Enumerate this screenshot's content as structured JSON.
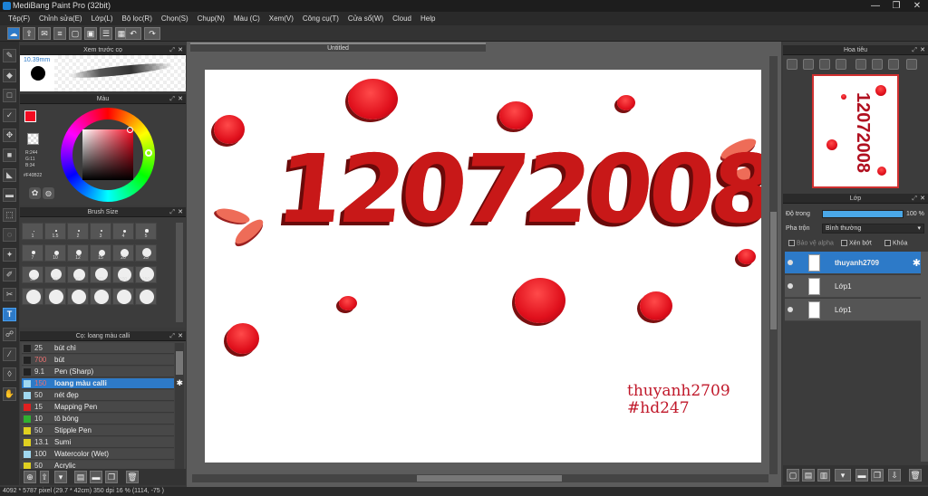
{
  "window": {
    "title": "MediBang Paint Pro (32bit)",
    "minimize": "—",
    "maximize": "❐",
    "close": "✕"
  },
  "menu": [
    "Tệp(F)",
    "Chỉnh sửa(E)",
    "Lớp(L)",
    "Bộ lọc(R)",
    "Chọn(S)",
    "Chụp(N)",
    "Màu (C)",
    "Xem(V)",
    "Công cụ(T)",
    "Cửa sổ(W)",
    "Cloud",
    "Help"
  ],
  "preview": {
    "title": "Xem trước cọ",
    "size": "10.39mm"
  },
  "color": {
    "title": "Màu",
    "r": "R:244",
    "g": "G:11",
    "b": "B:34",
    "hex": "#F40B22",
    "primary": "#f40b22",
    "secondary": "#2db34a"
  },
  "brush_size": {
    "title": "Brush Size",
    "sizes": [
      "1",
      "1.5",
      "2",
      "3",
      "4",
      "5",
      "7",
      "10",
      "12",
      "15",
      "20",
      "25",
      "30",
      "40",
      "50",
      "70",
      "100",
      "150",
      "",
      "",
      "",
      "",
      "",
      ""
    ]
  },
  "brush_list": {
    "title": "Cọ: loang màu calli",
    "items": [
      {
        "size": "25",
        "name": "bút chì",
        "color": "#222222"
      },
      {
        "size": "700",
        "name": "bút",
        "color": "#222222"
      },
      {
        "size": "9.1",
        "name": "Pen (Sharp)",
        "color": "#222222"
      },
      {
        "size": "150",
        "name": "loang màu calli",
        "color": "#a0d8f0"
      },
      {
        "size": "50",
        "name": "nét đẹp",
        "color": "#a0d8f0"
      },
      {
        "size": "15",
        "name": "Mapping Pen",
        "color": "#e02020"
      },
      {
        "size": "10",
        "name": "tô bóng",
        "color": "#30b030"
      },
      {
        "size": "50",
        "name": "Stipple Pen",
        "color": "#e0d020"
      },
      {
        "size": "13.1",
        "name": "Sumi",
        "color": "#e0d020"
      },
      {
        "size": "100",
        "name": "Watercolor (Wet)",
        "color": "#a0d8f0"
      },
      {
        "size": "50",
        "name": "Acrylic",
        "color": "#e0d020"
      }
    ]
  },
  "canvas": {
    "tab": "Untitled",
    "big_text": "12072008",
    "sig1": "thuyanh2709",
    "sig2": "#hd247"
  },
  "navigator": {
    "title": "Hoa tiêu"
  },
  "layers": {
    "title": "Lớp",
    "opacity_label": "Độ trong",
    "opacity_value": "100 %",
    "blend_label": "Pha trộn",
    "blend_value": "Bình thường",
    "protect_alpha": "Bảo vệ alpha",
    "clipping": "Xén bớt",
    "lock": "Khóa",
    "items": [
      "thuyanh2709",
      "Lớp1",
      "Lớp1"
    ]
  },
  "status": "4092 * 5787 pixel  (29.7 * 42cm)  350 dpi  16 %  (1114, -75 )"
}
